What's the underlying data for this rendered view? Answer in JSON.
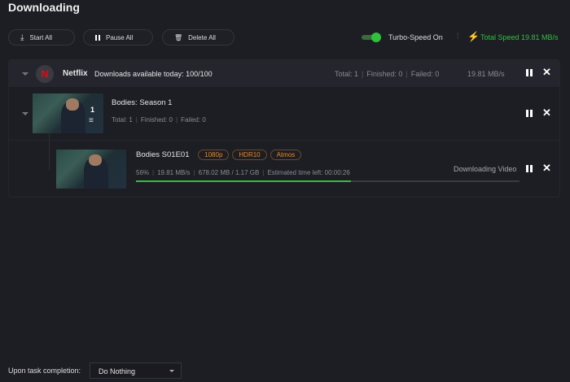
{
  "title": "Downloading",
  "toolbar": {
    "start_all": "Start All",
    "pause_all": "Pause All",
    "delete_all": "Delete All",
    "turbo_label": "Turbo-Speed On",
    "turbo_on": true,
    "total_speed": "Total Speed 19.81 MB/s"
  },
  "group": {
    "service": "Netflix",
    "available": "Downloads available today: 100/100",
    "total": "Total: 1",
    "finished": "Finished: 0",
    "failed": "Failed: 0",
    "speed": "19.81 MB/s"
  },
  "season": {
    "title": "Bodies: Season 1",
    "count": "1",
    "total": "Total: 1",
    "finished": "Finished: 0",
    "failed": "Failed: 0"
  },
  "episode": {
    "title": "Bodies S01E01",
    "tags": [
      "1080p",
      "HDR10",
      "Atmos"
    ],
    "percent_text": "56%",
    "speed": "19.81 MB/s",
    "size": "678.02 MB / 1.17 GB",
    "eta": "Estimated time left: 00:00:26",
    "status": "Downloading Video",
    "progress": 56
  },
  "footer": {
    "label": "Upon task completion:",
    "selected": "Do Nothing"
  },
  "colors": {
    "accent": "#2fc13a",
    "tag": "#e58a2a"
  }
}
